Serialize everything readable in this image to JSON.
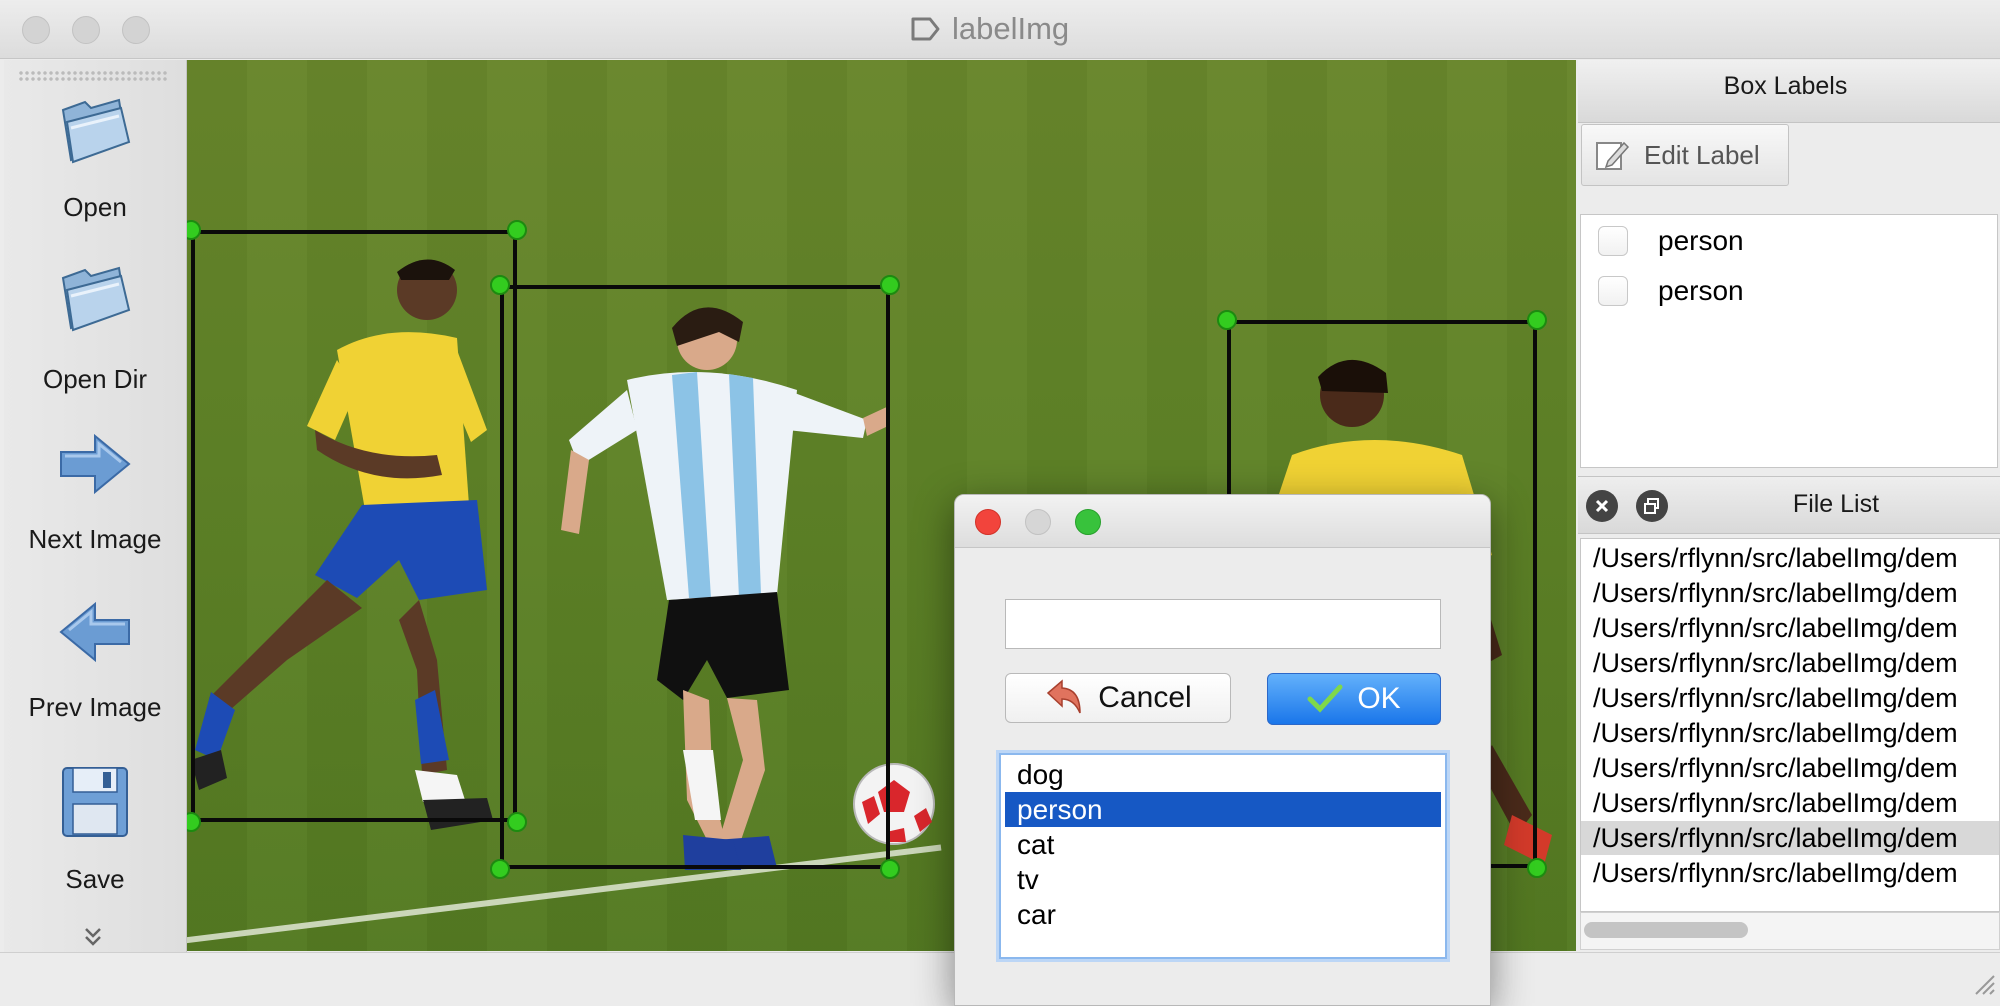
{
  "window": {
    "title": "labelImg",
    "traffic_lights": [
      "close",
      "minimize",
      "zoom"
    ]
  },
  "toolbar": {
    "items": [
      {
        "label": "Open",
        "icon": "folder-icon"
      },
      {
        "label": "Open Dir",
        "icon": "folder-icon"
      },
      {
        "label": "Next Image",
        "icon": "arrow-right-icon"
      },
      {
        "label": "Prev Image",
        "icon": "arrow-left-icon"
      },
      {
        "label": "Save",
        "icon": "floppy-disk-icon"
      }
    ],
    "more_icon": "chevron-double-down-icon"
  },
  "canvas": {
    "boxes": [
      {
        "label": "person"
      },
      {
        "label": "person"
      },
      {
        "label": "person"
      }
    ],
    "colors": {
      "box_stroke": "#0a0a0a",
      "handle_fill": "#33cc1f"
    }
  },
  "box_labels": {
    "title": "Box Labels",
    "edit_label_button": "Edit Label",
    "items": [
      {
        "label": "person",
        "checked": false
      },
      {
        "label": "person",
        "checked": false
      }
    ]
  },
  "file_list": {
    "title": "File List",
    "items": [
      "/Users/rflynn/src/labelImg/dem",
      "/Users/rflynn/src/labelImg/dem",
      "/Users/rflynn/src/labelImg/dem",
      "/Users/rflynn/src/labelImg/dem",
      "/Users/rflynn/src/labelImg/dem",
      "/Users/rflynn/src/labelImg/dem",
      "/Users/rflynn/src/labelImg/dem",
      "/Users/rflynn/src/labelImg/dem",
      "/Users/rflynn/src/labelImg/dem",
      "/Users/rflynn/src/labelImg/dem"
    ],
    "selected_index": 8
  },
  "dialog": {
    "input_value": "",
    "cancel_label": "Cancel",
    "ok_label": "OK",
    "choices": [
      "dog",
      "person",
      "cat",
      "tv",
      "car"
    ],
    "selected_choice": "person",
    "colors": {
      "ok_button": "#1a76ea",
      "selection": "#1658c4"
    }
  }
}
